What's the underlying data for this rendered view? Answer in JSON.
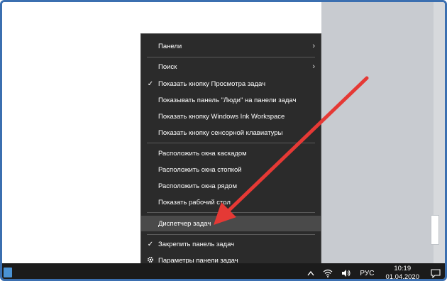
{
  "menu": {
    "items": [
      {
        "label": "Панели",
        "submenu": true
      },
      {
        "label": "Поиск",
        "submenu": true
      },
      {
        "label": "Показать кнопку Просмотра задач",
        "checked": true
      },
      {
        "label": "Показывать панель \"Люди\" на панели задач"
      },
      {
        "label": "Показать кнопку Windows Ink Workspace"
      },
      {
        "label": "Показать кнопку сенсорной клавиатуры"
      },
      {
        "label": "Расположить окна каскадом"
      },
      {
        "label": "Расположить окна стопкой"
      },
      {
        "label": "Расположить окна рядом"
      },
      {
        "label": "Показать рабочий стол"
      },
      {
        "label": "Диспетчер задач",
        "highlighted": true
      },
      {
        "label": "Закрепить панель задач",
        "checked": true
      },
      {
        "label": "Параметры панели задач",
        "icon": "gear-icon"
      }
    ],
    "check_mark": "✓",
    "submenu_arrow": "›"
  },
  "taskbar": {
    "language": "РУС",
    "time": "10:19",
    "date": "01.04.2020"
  },
  "colors": {
    "menu_bg": "#2b2b2b",
    "highlight": "#4a4a4a",
    "annotation_arrow": "#e53935",
    "frame": "#3b6fb0"
  }
}
